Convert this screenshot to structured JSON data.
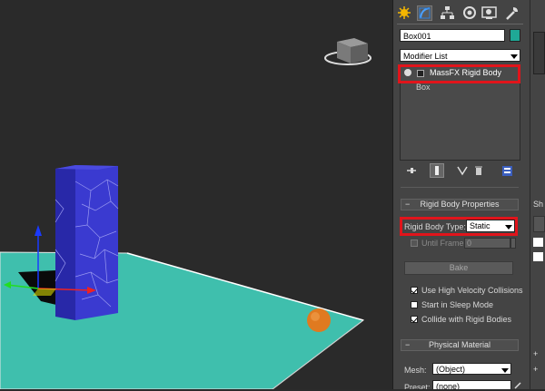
{
  "object_name": "Box001",
  "object_color": "#1fa896",
  "modifier_list": {
    "label": "Modifier List"
  },
  "modifier_stack": [
    {
      "label": "MassFX Rigid Body",
      "highlighted": true
    },
    {
      "label": "Box",
      "highlighted": false
    }
  ],
  "command_tabs": [
    "create-icon",
    "modify-icon",
    "hierarchy-icon",
    "motion-icon",
    "display-icon",
    "utilities-icon"
  ],
  "stack_tools": [
    "pin-stack-icon",
    "show-end-result-icon",
    "make-unique-icon",
    "remove-modifier-icon",
    "configure-modifier-sets-icon"
  ],
  "rigid_body_properties": {
    "title": "Rigid Body Properties",
    "type_label": "Rigid Body Type:",
    "type_value": "Static",
    "until_frame_label": "Until Frame:",
    "until_frame_value": "0",
    "bake_label": "Bake",
    "options": [
      {
        "label": "Use High Velocity Collisions",
        "checked": true
      },
      {
        "label": "Start in Sleep Mode",
        "checked": false
      },
      {
        "label": "Collide with Rigid Bodies",
        "checked": true
      }
    ]
  },
  "physical_material": {
    "title": "Physical Material",
    "mesh_label": "Mesh:",
    "mesh_value": "(Object)",
    "preset_label": "Preset:",
    "preset_value": "(none)"
  },
  "right_strip": {
    "partial_label": "Sh"
  },
  "colors": {
    "highlight": "#e1141b",
    "ground": "#3fbfad",
    "box": "#3a3ad0",
    "sphere": "#e07a20"
  }
}
